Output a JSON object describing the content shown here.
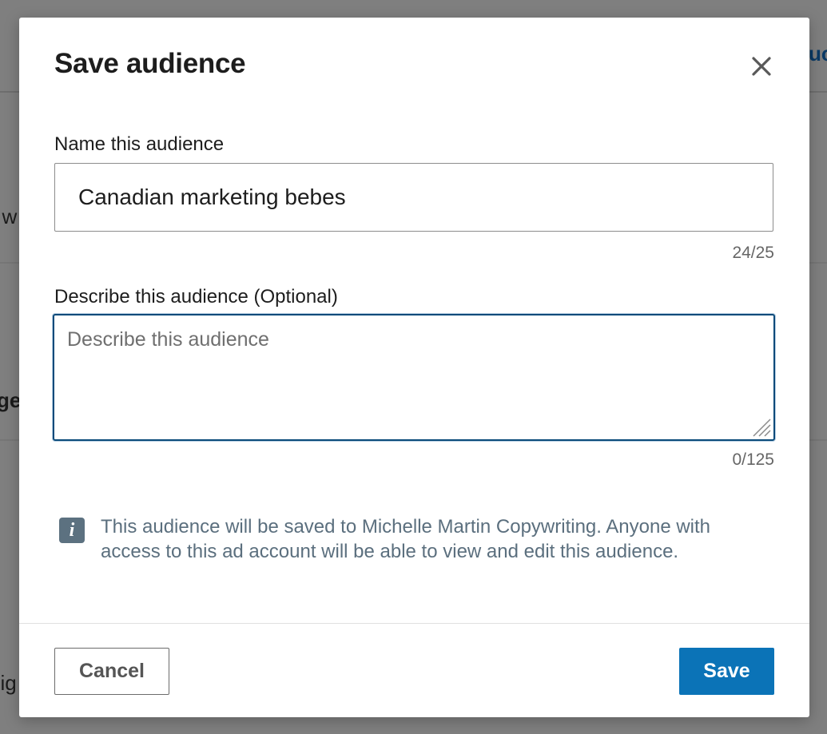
{
  "background": {
    "fragment_top_right": "uc",
    "fragment_left_1": "t w",
    "fragment_left_2": "ge",
    "fragment_left_3": "nig"
  },
  "modal": {
    "title": "Save audience",
    "close_icon": "close-icon",
    "name_field": {
      "label": "Name this audience",
      "value": "Canadian marketing bebes",
      "counter": "24/25"
    },
    "description_field": {
      "label": "Describe this audience (Optional)",
      "placeholder": "Describe this audience",
      "value": "",
      "counter": "0/125"
    },
    "info": {
      "icon": "info-icon",
      "text": "This audience will be saved to Michelle Martin Copywriting. Anyone with access to this ad account will be able to view and edit this audience."
    },
    "footer": {
      "cancel_label": "Cancel",
      "save_label": "Save"
    }
  },
  "colors": {
    "primary": "#0b73b7",
    "focus_border": "#0a4a7a",
    "info_text": "#5b6f7e",
    "overlay": "#7f7f7f"
  }
}
